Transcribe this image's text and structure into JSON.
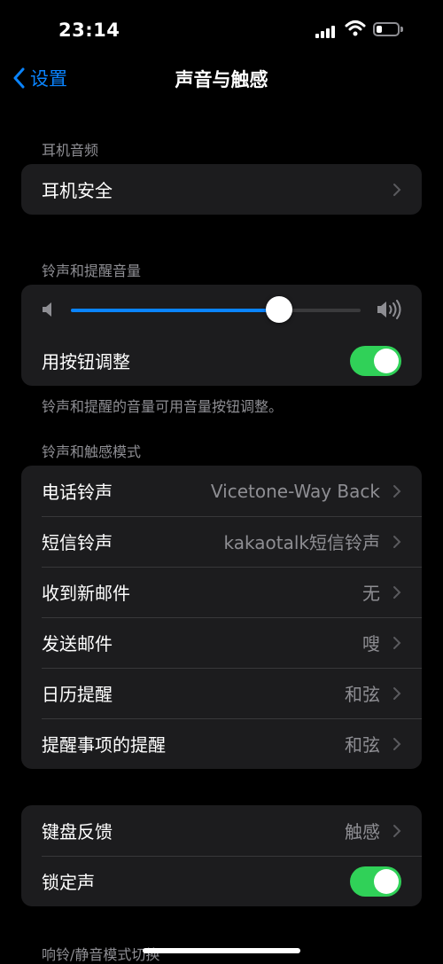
{
  "status_bar": {
    "time": "23:14",
    "battery_level": 0.25
  },
  "nav": {
    "back_label": "设置",
    "title": "声音与触感"
  },
  "headphone_section": {
    "header": "耳机音频",
    "items": [
      {
        "label": "耳机安全"
      }
    ]
  },
  "ringer_section": {
    "header": "铃声和提醒音量",
    "volume": 0.72,
    "change_with_buttons_label": "用按钮调整",
    "change_with_buttons_on": true,
    "footer": "铃声和提醒的音量可用音量按钮调整。"
  },
  "patterns_section": {
    "header": "铃声和触感模式",
    "items": [
      {
        "label": "电话铃声",
        "value": "Vicetone-Way Back"
      },
      {
        "label": "短信铃声",
        "value": "kakaotalk短信铃声"
      },
      {
        "label": "收到新邮件",
        "value": "无"
      },
      {
        "label": "发送邮件",
        "value": "嗖"
      },
      {
        "label": "日历提醒",
        "value": "和弦"
      },
      {
        "label": "提醒事项的提醒",
        "value": "和弦"
      }
    ]
  },
  "feedback_section": {
    "keyboard_label": "键盘反馈",
    "keyboard_value": "触感",
    "lock_sound_label": "锁定声",
    "lock_sound_on": true
  },
  "next_section": {
    "header": "响铃/静音模式切换"
  },
  "colors": {
    "accent": "#0a84ff",
    "toggle_on": "#30d158",
    "card_bg": "#1c1c1e",
    "secondary_text": "#8e8e93"
  }
}
